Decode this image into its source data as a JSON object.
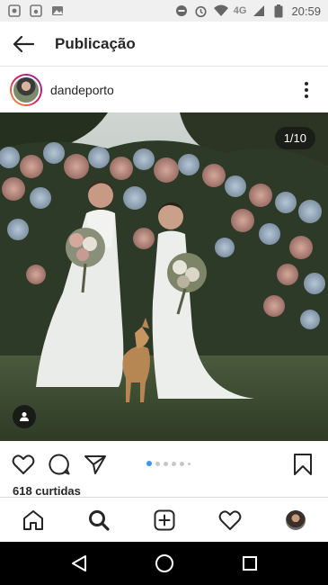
{
  "status_bar": {
    "time": "20:59",
    "network": "4G",
    "left_icons": [
      "photo-notification-icon",
      "camera-notification-icon",
      "image-notification-icon"
    ],
    "right_icons": [
      "do-not-disturb-icon",
      "alarm-icon",
      "wifi-icon",
      "signal-icon",
      "battery-icon"
    ]
  },
  "header": {
    "title": "Publicação",
    "back_icon": "arrow-left-icon"
  },
  "post": {
    "username": "dandeporto",
    "page_counter": "1/10",
    "likes": "618 curtidas",
    "carousel": {
      "total_dots": 6,
      "active_index": 0
    }
  },
  "colors": {
    "accent": "#3897f0",
    "text": "#262626",
    "story_ring_start": "#f9a825",
    "story_ring_end": "#8e24aa"
  },
  "bottom_nav": [
    "home-icon",
    "search-icon",
    "new-post-icon",
    "activity-heart-icon",
    "profile-avatar"
  ],
  "system_nav": [
    "back-triangle-icon",
    "home-circle-icon",
    "recents-square-icon"
  ]
}
